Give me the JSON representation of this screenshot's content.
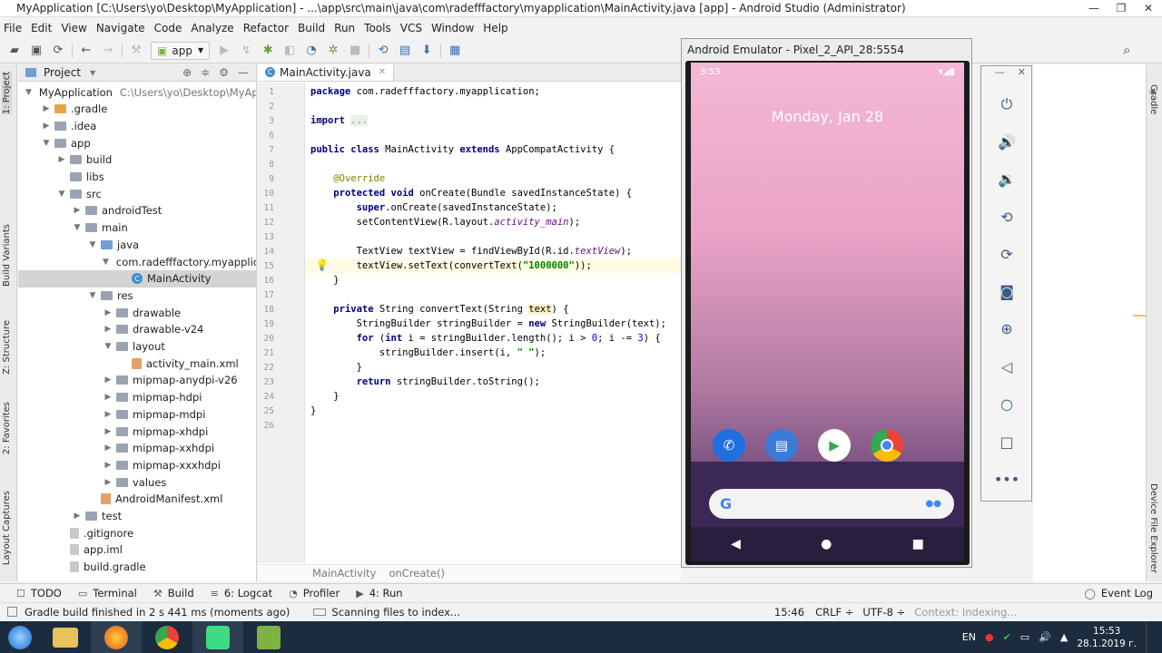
{
  "window": {
    "title": "MyApplication [C:\\Users\\yo\\Desktop\\MyApplication] - ...\\app\\src\\main\\java\\com\\radefffactory\\myapplication\\MainActivity.java [app] - Android Studio (Administrator)"
  },
  "menu": [
    "File",
    "Edit",
    "View",
    "Navigate",
    "Code",
    "Analyze",
    "Refactor",
    "Build",
    "Run",
    "Tools",
    "VCS",
    "Window",
    "Help"
  ],
  "toolbar": {
    "config": "app"
  },
  "sidebar_left": {
    "project": "1: Project",
    "build_variants": "Build Variants",
    "structure": "Z: Structure",
    "favorites": "2: Favorites",
    "captures": "Layout Captures"
  },
  "project_panel": {
    "title": "Project",
    "tree": [
      {
        "label": "MyApplication",
        "path": "C:\\Users\\yo\\Desktop\\MyApp",
        "depth": 0,
        "arrow": "▼",
        "icon": "folder"
      },
      {
        "label": ".gradle",
        "depth": 1,
        "arrow": "▶",
        "icon": "folder-orange"
      },
      {
        "label": ".idea",
        "depth": 1,
        "arrow": "▶",
        "icon": "folder"
      },
      {
        "label": "app",
        "depth": 1,
        "arrow": "▼",
        "icon": "folder"
      },
      {
        "label": "build",
        "depth": 2,
        "arrow": "▶",
        "icon": "folder"
      },
      {
        "label": "libs",
        "depth": 2,
        "arrow": "",
        "icon": "folder"
      },
      {
        "label": "src",
        "depth": 2,
        "arrow": "▼",
        "icon": "folder"
      },
      {
        "label": "androidTest",
        "depth": 3,
        "arrow": "▶",
        "icon": "folder"
      },
      {
        "label": "main",
        "depth": 3,
        "arrow": "▼",
        "icon": "folder"
      },
      {
        "label": "java",
        "depth": 4,
        "arrow": "▼",
        "icon": "folder-blue"
      },
      {
        "label": "com.radefffactory.myapplica",
        "depth": 5,
        "arrow": "▼",
        "icon": "folder"
      },
      {
        "label": "MainActivity",
        "depth": 6,
        "arrow": "",
        "icon": "class",
        "selected": true
      },
      {
        "label": "res",
        "depth": 4,
        "arrow": "▼",
        "icon": "folder"
      },
      {
        "label": "drawable",
        "depth": 5,
        "arrow": "▶",
        "icon": "folder"
      },
      {
        "label": "drawable-v24",
        "depth": 5,
        "arrow": "▶",
        "icon": "folder"
      },
      {
        "label": "layout",
        "depth": 5,
        "arrow": "▼",
        "icon": "folder"
      },
      {
        "label": "activity_main.xml",
        "depth": 6,
        "arrow": "",
        "icon": "xml"
      },
      {
        "label": "mipmap-anydpi-v26",
        "depth": 5,
        "arrow": "▶",
        "icon": "folder"
      },
      {
        "label": "mipmap-hdpi",
        "depth": 5,
        "arrow": "▶",
        "icon": "folder"
      },
      {
        "label": "mipmap-mdpi",
        "depth": 5,
        "arrow": "▶",
        "icon": "folder"
      },
      {
        "label": "mipmap-xhdpi",
        "depth": 5,
        "arrow": "▶",
        "icon": "folder"
      },
      {
        "label": "mipmap-xxhdpi",
        "depth": 5,
        "arrow": "▶",
        "icon": "folder"
      },
      {
        "label": "mipmap-xxxhdpi",
        "depth": 5,
        "arrow": "▶",
        "icon": "folder"
      },
      {
        "label": "values",
        "depth": 5,
        "arrow": "▶",
        "icon": "folder"
      },
      {
        "label": "AndroidManifest.xml",
        "depth": 4,
        "arrow": "",
        "icon": "xml"
      },
      {
        "label": "test",
        "depth": 3,
        "arrow": "▶",
        "icon": "folder"
      },
      {
        "label": ".gitignore",
        "depth": 2,
        "arrow": "",
        "icon": "file"
      },
      {
        "label": "app.iml",
        "depth": 2,
        "arrow": "",
        "icon": "file"
      },
      {
        "label": "build.gradle",
        "depth": 2,
        "arrow": "",
        "icon": "file"
      }
    ]
  },
  "editor": {
    "tab": "MainActivity.java",
    "breadcrumb": [
      "MainActivity",
      "onCreate()"
    ],
    "lines": [
      {
        "n": "1",
        "html": "<span class=\"kw\">package</span> com.radefffactory.myapplication;"
      },
      {
        "n": "2",
        "html": ""
      },
      {
        "n": "3",
        "html": "<span class=\"kw\">import</span> <span class=\"fold\">...</span>"
      },
      {
        "n": "6",
        "html": ""
      },
      {
        "n": "7",
        "html": "<span class=\"kw\">public class</span> MainActivity <span class=\"kw\">extends</span> AppCompatActivity {"
      },
      {
        "n": "8",
        "html": ""
      },
      {
        "n": "9",
        "html": "    <span class=\"ann\">@Override</span>"
      },
      {
        "n": "10",
        "html": "    <span class=\"kw\">protected void</span> onCreate(Bundle savedInstanceState) {"
      },
      {
        "n": "11",
        "html": "        <span class=\"kw\">super</span>.onCreate(savedInstanceState);"
      },
      {
        "n": "12",
        "html": "        setContentView(R.layout.<span class=\"it\">activity_main</span>);"
      },
      {
        "n": "13",
        "html": ""
      },
      {
        "n": "14",
        "html": "        TextView textView = findViewById(R.id.<span class=\"it\">textView</span>);"
      },
      {
        "n": "15",
        "html": "        textView.setText(convertText(<span class=\"str\">\"1000000\"</span>));"
      },
      {
        "n": "16",
        "html": "    }"
      },
      {
        "n": "17",
        "html": ""
      },
      {
        "n": "18",
        "html": "    <span class=\"kw\">private</span> String convertText(String <span class=\"hl\">text</span>) {"
      },
      {
        "n": "19",
        "html": "        StringBuilder stringBuilder = <span class=\"kw\">new</span> StringBuilder(text);"
      },
      {
        "n": "20",
        "html": "        <span class=\"kw\">for</span> (<span class=\"kw\">int</span> i = stringBuilder.length(); i &gt; <span style=\"color:#0000ff\">0</span>; i -= <span style=\"color:#0000ff\">3</span>) {"
      },
      {
        "n": "21",
        "html": "            stringBuilder.insert(i, <span class=\"str\">\" \"</span>);"
      },
      {
        "n": "22",
        "html": "        }"
      },
      {
        "n": "23",
        "html": "        <span class=\"kw\">return</span> stringBuilder.toString();"
      },
      {
        "n": "24",
        "html": "    }"
      },
      {
        "n": "25",
        "html": "}"
      },
      {
        "n": "26",
        "html": ""
      }
    ]
  },
  "emulator": {
    "title": "Android Emulator - Pixel_2_API_28:5554",
    "time": "3:53",
    "date": "Monday, Jan 28",
    "google_g": "G"
  },
  "sidebar_right": {
    "gradle": "Gradle",
    "device_file_explorer": "Device File Explorer"
  },
  "bottom_tabs": [
    {
      "label": "TODO",
      "icon": "☐"
    },
    {
      "label": "Terminal",
      "icon": "▭"
    },
    {
      "label": "Build",
      "icon": "⚒"
    },
    {
      "label": "6: Logcat",
      "icon": "≡"
    },
    {
      "label": "Profiler",
      "icon": "◔"
    },
    {
      "label": "4: Run",
      "icon": "▶"
    }
  ],
  "event_log": "Event Log",
  "status": {
    "message": "Gradle build finished in 2 s 441 ms (moments ago)",
    "indexing": "Scanning files to index...",
    "position": "15:46",
    "line_sep": "CRLF ÷",
    "encoding": "UTF-8 ÷",
    "context": "Context: Indexing..."
  },
  "taskbar": {
    "lang": "EN",
    "time": "15:53",
    "date": "28.1.2019 г."
  },
  "colors": {
    "accent": "#3d8fd1",
    "taskbar": "#1c2b3d"
  }
}
